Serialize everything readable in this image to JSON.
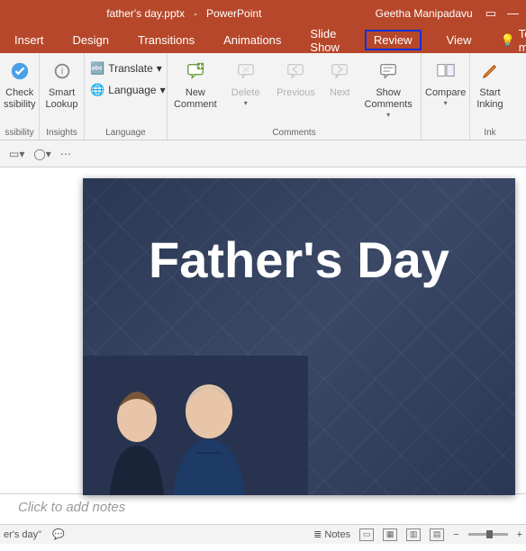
{
  "title": {
    "file": "father's day.pptx",
    "sep": "-",
    "app": "PowerPoint",
    "user": "Geetha Manipadavu"
  },
  "tabs": {
    "insert": "Insert",
    "design": "Design",
    "transitions": "Transitions",
    "animations": "Animations",
    "slideshow": "Slide Show",
    "review": "Review",
    "view": "View",
    "tellme": "Tell me"
  },
  "ribbon": {
    "accessibility": {
      "btn1": "Check",
      "btn1b": "ssibility",
      "group": "ssibility"
    },
    "insights": {
      "btn": "Smart\nLookup",
      "group": "Insights"
    },
    "language": {
      "translate": "Translate",
      "language": "Language",
      "group": "Language"
    },
    "comments": {
      "new": "New\nComment",
      "delete": "Delete",
      "previous": "Previous",
      "next": "Next",
      "show": "Show\nComments",
      "group": "Comments"
    },
    "compare": {
      "btn": "Compare"
    },
    "ink": {
      "btn": "Start\nInking",
      "group": "Ink"
    }
  },
  "slide": {
    "title": "Father's Day"
  },
  "notes": {
    "placeholder": "Click to add notes"
  },
  "status": {
    "left": "er's day\"",
    "notes": "Notes",
    "minus": "−",
    "plus": "+"
  }
}
